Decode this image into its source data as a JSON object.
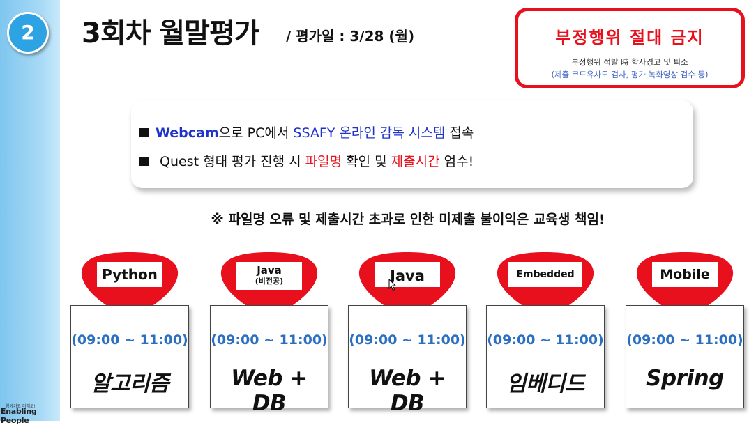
{
  "slide": {
    "number": "2",
    "title": "3회차 월말평가",
    "subtitle": "/ 평가일 : 3/28 (월)",
    "brand_small": "함께가요 미래로!",
    "brand": "Enabling People"
  },
  "warning": {
    "title": "부정행위 절대 금지",
    "line1": "부정행위 적발 時 학사경고 및 퇴소",
    "line2": "(제출 코드유사도 검사, 평가 녹화영상 검수 등)"
  },
  "info": {
    "line1": {
      "p1": "Webcam",
      "p2": "으로  PC에서 ",
      "p3": "SSAFY 온라인 감독 시스템",
      "p4": " 접속"
    },
    "line2": {
      "p1": " Quest 형태 평가 진행 시 ",
      "p2": "파일명",
      "p3": " 확인 및 ",
      "p4": "제출시간",
      "p5": " 엄수!"
    }
  },
  "notice": "※ 파일명 오류 및 제출시간 초과로 인한 미제출 불이익은 교육생 책임!",
  "tracks": [
    {
      "label": "Python",
      "sub": "",
      "time": "(09:00 ~ 11:00)",
      "subject": "알고리즘"
    },
    {
      "label": "Java",
      "sub": "(비전공)",
      "time": "(09:00 ~ 11:00)",
      "subject": "Web + DB"
    },
    {
      "label": "Java",
      "sub": "",
      "time": "(09:00 ~ 11:00)",
      "subject": "Web + DB"
    },
    {
      "label": "Embedded",
      "sub": "",
      "time": "(09:00 ~ 11:00)",
      "subject": "임베디드"
    },
    {
      "label": "Mobile",
      "sub": "",
      "time": "(09:00 ~ 11:00)",
      "subject": "Spring"
    }
  ],
  "colors": {
    "accent_red": "#e8101c",
    "accent_blue": "#2033c9",
    "time_blue": "#2a6fc2",
    "badge_blue": "#2ea3e3"
  }
}
